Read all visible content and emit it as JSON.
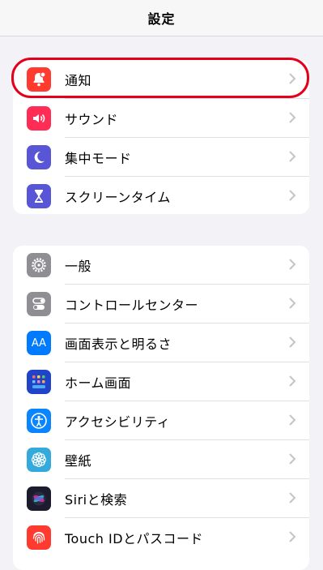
{
  "header": {
    "title": "設定"
  },
  "group1": [
    {
      "label": "通知",
      "icon": "bell-icon",
      "color": "#ff3b30"
    },
    {
      "label": "サウンド",
      "icon": "speaker-icon",
      "color": "#ff2d55"
    },
    {
      "label": "集中モード",
      "icon": "moon-icon",
      "color": "#5856d6"
    },
    {
      "label": "スクリーンタイム",
      "icon": "hourglass-icon",
      "color": "#5856d6"
    }
  ],
  "group2": [
    {
      "label": "一般",
      "icon": "gear-icon",
      "color": "#8e8e93"
    },
    {
      "label": "コントロールセンター",
      "icon": "toggle-icon",
      "color": "#8e8e93"
    },
    {
      "label": "画面表示と明るさ",
      "icon": "text-size-icon",
      "color": "#007aff"
    },
    {
      "label": "ホーム画面",
      "icon": "home-grid-icon",
      "color": "#1f44c9"
    },
    {
      "label": "アクセシビリティ",
      "icon": "accessibility-icon",
      "color": "#0a84ff"
    },
    {
      "label": "壁紙",
      "icon": "flower-icon",
      "color": "#34aadc"
    },
    {
      "label": "Siriと検索",
      "icon": "siri-icon",
      "color": "#1c1c2e"
    },
    {
      "label": "Touch IDとパスコード",
      "icon": "fingerprint-icon",
      "color": "#ff3b30"
    }
  ],
  "icon_text": {
    "display": "AA"
  },
  "highlight_color": "#e3001b"
}
